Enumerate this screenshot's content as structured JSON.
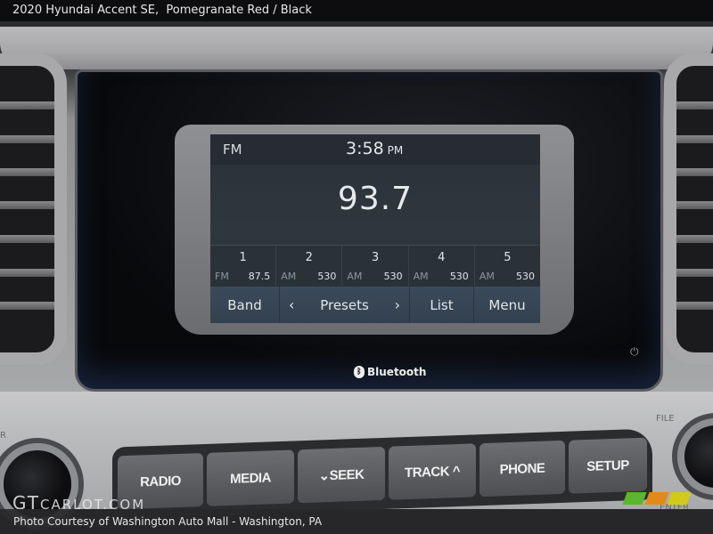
{
  "page": {
    "title": "2020 Hyundai Accent SE,  Pomegranate Red / Black",
    "footer": "Photo Courtesy of Washington Auto Mall - Washington, PA",
    "watermark_main": "GT",
    "watermark_rest": "CARLOT.COM"
  },
  "screen": {
    "band": "FM",
    "time": "3:58",
    "ampm": "PM",
    "frequency": "93.7",
    "presets": [
      {
        "number": "1",
        "band": "FM",
        "frequency": "87.5"
      },
      {
        "number": "2",
        "band": "AM",
        "frequency": "530"
      },
      {
        "number": "3",
        "band": "AM",
        "frequency": "530"
      },
      {
        "number": "4",
        "band": "AM",
        "frequency": "530"
      },
      {
        "number": "5",
        "band": "AM",
        "frequency": "530"
      }
    ],
    "softkeys": {
      "band": "Band",
      "prev": "‹",
      "presets": "Presets",
      "next": "›",
      "list": "List",
      "menu": "Menu"
    },
    "colors": {
      "screen_bg": "#2f373e",
      "softkey_bg": "#3b4a5a",
      "text": "#e4e7ea"
    }
  },
  "bezel": {
    "bluetooth_label": "Bluetooth",
    "power_icon": "⏻"
  },
  "hardware_buttons": {
    "radio": "RADIO",
    "media": "MEDIA",
    "seek": "⌄SEEK",
    "track": "TRACK ^",
    "phone": "PHONE",
    "setup": "SETUP"
  },
  "labels": {
    "file": "FILE",
    "enter": "ENTER",
    "left_partial": "R"
  },
  "stripe_colors": [
    "#5ab52f",
    "#e08a1a",
    "#d6c81a"
  ]
}
